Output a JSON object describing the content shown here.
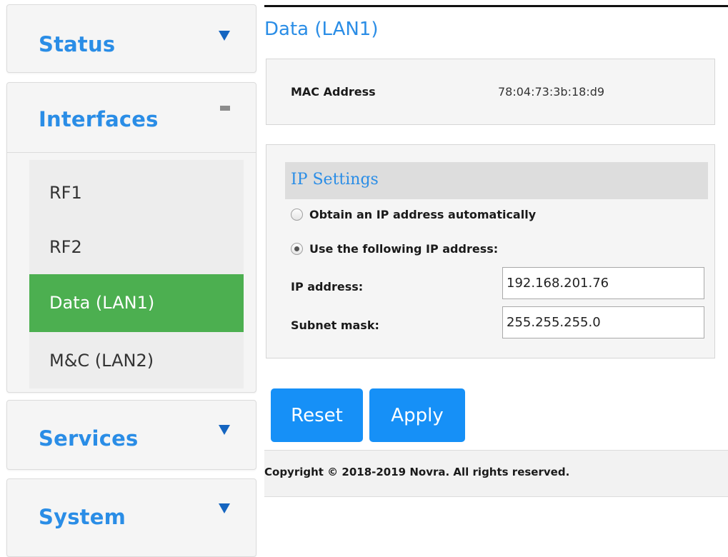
{
  "sidebar": {
    "status": {
      "label": "Status"
    },
    "interfaces": {
      "label": "Interfaces",
      "items": [
        {
          "label": "RF1"
        },
        {
          "label": "RF2"
        },
        {
          "label": "Data (LAN1)",
          "active": true
        },
        {
          "label": "M&C (LAN2)"
        }
      ]
    },
    "services": {
      "label": "Services"
    },
    "system": {
      "label": "System"
    }
  },
  "main": {
    "title": "Data (LAN1)",
    "mac": {
      "label": "MAC Address",
      "value": "78:04:73:3b:18:d9"
    },
    "ip_settings": {
      "heading": "IP Settings",
      "option_auto": "Obtain an IP address automatically",
      "option_static": "Use the following IP address:",
      "selected": "static",
      "ip_label": "IP address:",
      "ip_value": "192.168.201.76",
      "mask_label": "Subnet mask:",
      "mask_value": "255.255.255.0"
    },
    "buttons": {
      "reset": "Reset",
      "apply": "Apply"
    },
    "footer": "Copyright © 2018-2019 Novra. All rights reserved."
  },
  "colors": {
    "accent_blue": "#2a8de6",
    "button_blue": "#1690f7",
    "active_green": "#4caf50"
  }
}
